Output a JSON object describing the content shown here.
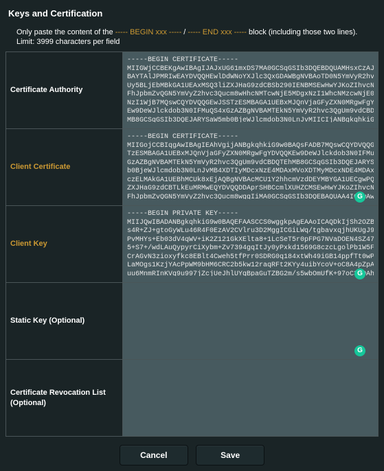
{
  "title": "Keys and Certification",
  "hint_pre": "Only paste the content of the ",
  "hint_begin": "----- BEGIN xxx -----",
  "hint_sep": " / ",
  "hint_end": "----- END xxx -----",
  "hint_post": " block (including those two lines).",
  "limit": "Limit: 3999 characters per field",
  "fields": {
    "ca": {
      "label": "Certificate Authority",
      "value": "-----BEGIN CERTIFICATE-----\nMIIGWjCCBEKgAwIBAgIJAJxUG61mxDS7MA0GCSqGSIb3DQEBDQUAMHsxCzAJBgNV\nBAYTAlJPMRIwEAYDVQQHEwlDdWNoYXJlc3QxGDAWBgNVBAoTD0N5YmVyR2hvc3Qg\nUy5BLjEbMBkGA1UEAxMSQ3liZXJHaG9zdCBSb290IENBMSEwHwYJKoZIhvcNAQkB\nFhJpbmZvQGN5YmVyZ2hvc3Qucm8wHhcNMTcwNjE5MDgxNzI1WhcNMzcwNjE0MDgx\nNzI1WjB7MQswCQYDVQQGEwJSSTzESMBAGA1UEBxMJQnVjaGFyZXN0MRgwFgYDVQQK\nEw9DeWJlckdob3N0IFMuQS4xGzAZBgNVBAMTEkN5YmVyR2hvc3QgUm9vdCBDQTEh\nMB8GCSqGSIb3DQEJARYSaW5mb0BjeWJlcmdob3N0LnJvMIICIjANBgkqhkiG9w0B"
    },
    "client_cert": {
      "label": "Client Certificate",
      "value": "-----BEGIN CERTIFICATE-----\nMIIGojCCBIqgAwIBAgIEAhVgijANBgkqhkiG9w0BAQsFADB7MQswCQYDVQQGEwJS\nTzESMBAGA1UEBxMJQnVjaGFyZXN0MRgwFgYDVQQKEw9DeWJlckdob3N0IFMuQS4x\nGzAZBgNVBAMTEkN5YmVyR2hvc3QgUm9vdCBDQTEhMB8GCSqGSIb3DQEJARYSaW5m\nb0BjeWJlcmdob3N0LnJvMB4XDTIyMDcxNzE4MDAxMVoXDTMyMDcxNDE4MDAxMVow\nczELMAkGA1UEBhMCUk8xEjAQBgNVBAcMCU1Y2hhcmVzdDEYMBYGA1UECgwPQ3li\nZXJHaG9zdCBTLkEuMRMwEQYDVQQDDAprSHBCcmlXUHZCMSEwHwYJKoZIhvcNAQkB\nFhJpbmZvQGN5YmVyZ2hvc3Qucm8wggIiMA0GCSqGSIb3DQEBAQUAA4ICDwAwggIK"
    },
    "client_key": {
      "label": "Client Key",
      "value": "-----BEGIN PRIVATE KEY-----\nMIIJQwIBADANBgkqhkiG9w0BAQEFAASCCS0wggkpAgEAAoICAQDkIjSh2OZBGMHY\ns4R+ZJ+gtoGyWLu46R4F0EzAV2CVlru3D2MggICGiLWq/tgbavxqjhUKUgJ9b41N\nPvMHYs+Eb03dV4qWV+iK2Z121GkXElta8+1LcSeT5r0pFPG7NVaDOEN4SZ47D6w\n5+S7+/wdLAuQypyrCiXybm+Zv7394gqItJy0yPxkd1569G8czcLgolPb1W5FEsCk\nCrAGvN3zioxyfkc8EBlt4Cweh5tfPrr0SDRG0q184xtWh49iGB14ppfTt0wPZ1k1D\nLaMOgs1KzjYAcPpWM9bHM6CRC2b5kw12raqRFt2KYy4uibYcoV+oC8A4pZpALkBg\nuu6MnmRInKVq9u997jZcjUeJhlUYqBpaGuTZBG2m/s5wbOmUfK+97oC3JOAh9fJV"
    },
    "static_key": {
      "label": "Static Key (Optional)",
      "value": ""
    },
    "crl": {
      "label": "Certificate Revocation List (Optional)",
      "value": ""
    }
  },
  "buttons": {
    "cancel": "Cancel",
    "save": "Save"
  },
  "colors": {
    "accent": "#cc9933",
    "bg": "#1a2426",
    "field_bg": "#475a5f",
    "badge": "#16c79a"
  }
}
